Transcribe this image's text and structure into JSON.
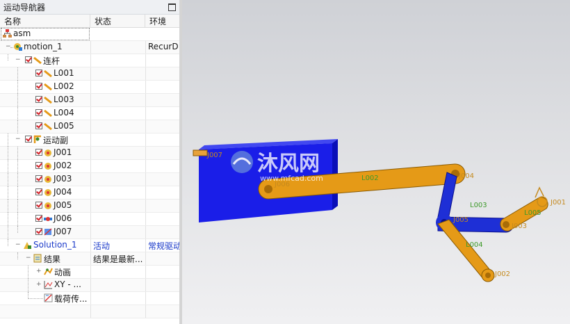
{
  "navigator": {
    "title": "运动导航器",
    "columns": [
      "名称",
      "状态",
      "环境"
    ],
    "rows": [
      {
        "name": "asm",
        "status": "",
        "env": "",
        "icon": "assembly-icon"
      },
      {
        "name": "motion_1",
        "status": "",
        "env": "RecurD",
        "icon": "motion-icon"
      },
      {
        "name": "连杆",
        "status": "",
        "env": "",
        "icon": "link-folder-icon"
      },
      {
        "name": "L001",
        "status": "",
        "env": "",
        "icon": "link-icon"
      },
      {
        "name": "L002",
        "status": "",
        "env": "",
        "icon": "link-icon"
      },
      {
        "name": "L003",
        "status": "",
        "env": "",
        "icon": "link-icon"
      },
      {
        "name": "L004",
        "status": "",
        "env": "",
        "icon": "link-icon"
      },
      {
        "name": "L005",
        "status": "",
        "env": "",
        "icon": "link-icon"
      },
      {
        "name": "运动副",
        "status": "",
        "env": "",
        "icon": "joint-folder-icon"
      },
      {
        "name": "J001",
        "status": "",
        "env": "",
        "icon": "revolute-joint-icon"
      },
      {
        "name": "J002",
        "status": "",
        "env": "",
        "icon": "revolute-joint-icon"
      },
      {
        "name": "J003",
        "status": "",
        "env": "",
        "icon": "revolute-joint-icon"
      },
      {
        "name": "J004",
        "status": "",
        "env": "",
        "icon": "revolute-joint-icon"
      },
      {
        "name": "J005",
        "status": "",
        "env": "",
        "icon": "revolute-joint-icon"
      },
      {
        "name": "J006",
        "status": "",
        "env": "",
        "icon": "slider-joint-icon"
      },
      {
        "name": "J007",
        "status": "",
        "env": "",
        "icon": "fixed-joint-icon"
      },
      {
        "name": "Solution_1",
        "status": "活动",
        "env": "常规驱动",
        "icon": "solution-icon"
      },
      {
        "name": "结果",
        "status": "结果是最新...",
        "env": "",
        "icon": "results-icon"
      },
      {
        "name": "动画",
        "status": "",
        "env": "",
        "icon": "animation-icon"
      },
      {
        "name": "XY - ...",
        "status": "",
        "env": "",
        "icon": "xy-graph-icon"
      },
      {
        "name": "载荷传...",
        "status": "",
        "env": "",
        "icon": "load-transfer-icon"
      }
    ]
  },
  "viewport": {
    "watermark_title": "沐风网",
    "watermark_url": "www.mfcad.com",
    "labels": {
      "j007": "J007",
      "j006": "J006",
      "l002": "L002",
      "j004": "J004",
      "l003": "L003",
      "j005": "J005",
      "j003": "J003",
      "l004": "L004",
      "j002": "J002",
      "l005": "L005",
      "j001": "J001"
    },
    "colors": {
      "link": "#e59a17",
      "link_edge": "#8a5a00",
      "block": "#1a1ee8",
      "blue_link": "#1e2fd6",
      "label_orange": "#c58a1e",
      "label_green": "#3d9a2a"
    }
  }
}
